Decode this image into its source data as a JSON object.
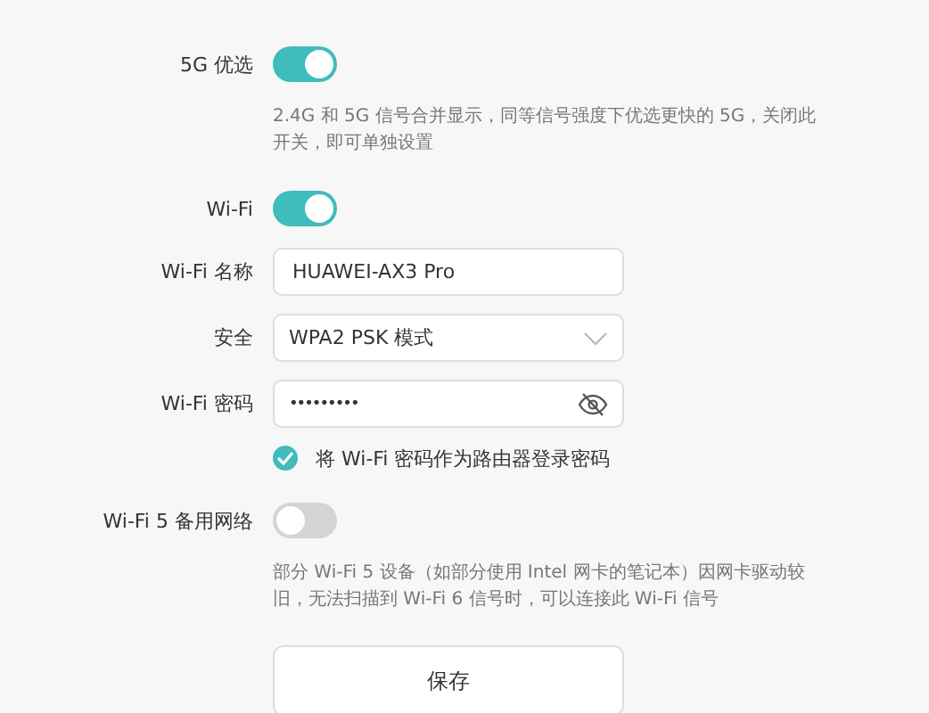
{
  "rows": [
    {
      "kind": "toggle",
      "label": "5G 优选",
      "on": true
    },
    {
      "kind": "hint",
      "text": "2.4G 和 5G 信号合并显示，同等信号强度下优选更快的 5G，关闭此开关，即可单独设置"
    },
    {
      "kind": "toggle",
      "label": "Wi-Fi",
      "on": true
    },
    {
      "kind": "text",
      "label": "Wi-Fi 名称",
      "value": "HUAWEI-AX3 Pro"
    },
    {
      "kind": "select",
      "label": "安全",
      "value": "WPA2 PSK 模式"
    },
    {
      "kind": "password",
      "label": "Wi-Fi 密码",
      "value": "•••••••••"
    },
    {
      "kind": "checkbox",
      "label": "将 Wi-Fi 密码作为路由器登录密码",
      "checked": true
    },
    {
      "kind": "toggle",
      "label": "Wi-Fi 5 备用网络",
      "on": false
    },
    {
      "kind": "hint",
      "text": "部分 Wi-Fi 5 设备（如部分使用 Intel 网卡的笔记本）因网卡驱动较旧，无法扫描到 Wi-Fi 6 信号时，可以连接此 Wi-Fi 信号"
    }
  ],
  "save_button": "保存"
}
